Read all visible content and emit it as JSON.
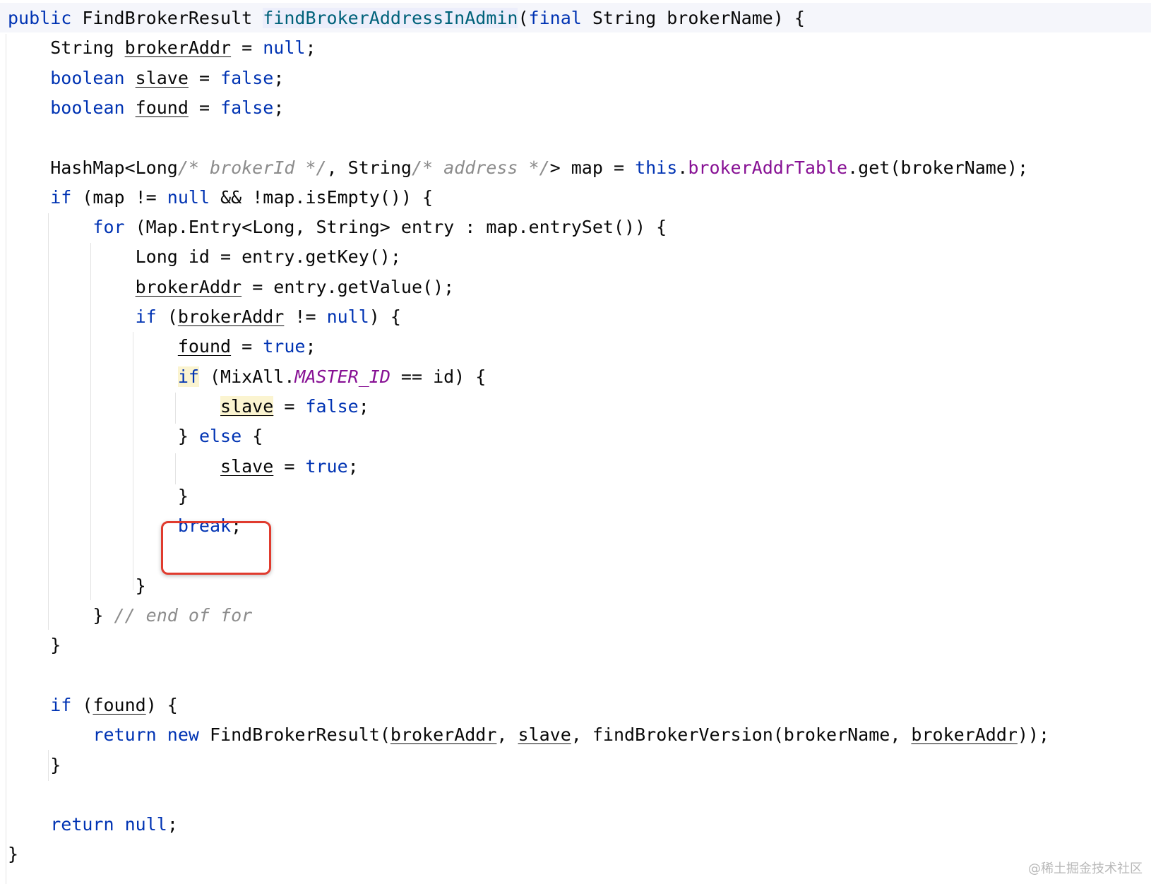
{
  "editor": {
    "lines": [
      {
        "tokens": [
          {
            "t": "public",
            "c": "kw"
          },
          {
            "t": " FindBrokerResult ",
            "c": ""
          },
          {
            "t": "findBrokerAddressInAdmin",
            "c": "fn hl-method"
          },
          {
            "t": "(",
            "c": ""
          },
          {
            "t": "final",
            "c": "kw"
          },
          {
            "t": " String brokerName) {",
            "c": ""
          }
        ]
      },
      {
        "tokens": [
          {
            "t": "    String ",
            "c": ""
          },
          {
            "t": "brokerAddr",
            "c": "u"
          },
          {
            "t": " = ",
            "c": ""
          },
          {
            "t": "null",
            "c": "kw"
          },
          {
            "t": ";",
            "c": ""
          }
        ]
      },
      {
        "tokens": [
          {
            "t": "    ",
            "c": ""
          },
          {
            "t": "boolean",
            "c": "kw"
          },
          {
            "t": " ",
            "c": ""
          },
          {
            "t": "slave",
            "c": "u"
          },
          {
            "t": " = ",
            "c": ""
          },
          {
            "t": "false",
            "c": "kw"
          },
          {
            "t": ";",
            "c": ""
          }
        ]
      },
      {
        "tokens": [
          {
            "t": "    ",
            "c": ""
          },
          {
            "t": "boolean",
            "c": "kw"
          },
          {
            "t": " ",
            "c": ""
          },
          {
            "t": "found",
            "c": "u"
          },
          {
            "t": " = ",
            "c": ""
          },
          {
            "t": "false",
            "c": "kw"
          },
          {
            "t": ";",
            "c": ""
          }
        ]
      },
      {
        "tokens": []
      },
      {
        "tokens": [
          {
            "t": "    HashMap<Long",
            "c": ""
          },
          {
            "t": "/* brokerId */",
            "c": "cmt"
          },
          {
            "t": ", String",
            "c": ""
          },
          {
            "t": "/* address */",
            "c": "cmt"
          },
          {
            "t": "> map = ",
            "c": ""
          },
          {
            "t": "this",
            "c": "kw"
          },
          {
            "t": ".",
            "c": ""
          },
          {
            "t": "brokerAddrTable",
            "c": "fld"
          },
          {
            "t": ".get(brokerName);",
            "c": ""
          }
        ]
      },
      {
        "tokens": [
          {
            "t": "    ",
            "c": ""
          },
          {
            "t": "if",
            "c": "kw"
          },
          {
            "t": " (map != ",
            "c": ""
          },
          {
            "t": "null",
            "c": "kw"
          },
          {
            "t": " && !map.isEmpty()) {",
            "c": ""
          }
        ]
      },
      {
        "tokens": [
          {
            "t": "        ",
            "c": ""
          },
          {
            "t": "for",
            "c": "kw"
          },
          {
            "t": " (Map.Entry<Long, String> entry : map.entrySet()) {",
            "c": ""
          }
        ]
      },
      {
        "tokens": [
          {
            "t": "            Long id = entry.getKey();",
            "c": ""
          }
        ]
      },
      {
        "tokens": [
          {
            "t": "            ",
            "c": ""
          },
          {
            "t": "brokerAddr",
            "c": "u"
          },
          {
            "t": " = entry.getValue();",
            "c": ""
          }
        ]
      },
      {
        "tokens": [
          {
            "t": "            ",
            "c": ""
          },
          {
            "t": "if",
            "c": "kw"
          },
          {
            "t": " (",
            "c": ""
          },
          {
            "t": "brokerAddr",
            "c": "u"
          },
          {
            "t": " != ",
            "c": ""
          },
          {
            "t": "null",
            "c": "kw"
          },
          {
            "t": ") {",
            "c": ""
          }
        ]
      },
      {
        "tokens": [
          {
            "t": "                ",
            "c": ""
          },
          {
            "t": "found",
            "c": "u"
          },
          {
            "t": " = ",
            "c": ""
          },
          {
            "t": "true",
            "c": "kw"
          },
          {
            "t": ";",
            "c": ""
          }
        ]
      },
      {
        "tokens": [
          {
            "t": "                ",
            "c": ""
          },
          {
            "t": "if",
            "c": "kw hl-yellow"
          },
          {
            "t": " (MixAll.",
            "c": ""
          },
          {
            "t": "MASTER_ID",
            "c": "cst"
          },
          {
            "t": " == id) {",
            "c": ""
          }
        ]
      },
      {
        "tokens": [
          {
            "t": "                    ",
            "c": ""
          },
          {
            "t": "slave",
            "c": "u hl-yellow"
          },
          {
            "t": " = ",
            "c": ""
          },
          {
            "t": "false",
            "c": "kw"
          },
          {
            "t": ";",
            "c": ""
          }
        ]
      },
      {
        "tokens": [
          {
            "t": "                } ",
            "c": ""
          },
          {
            "t": "else",
            "c": "kw"
          },
          {
            "t": " {",
            "c": ""
          }
        ]
      },
      {
        "tokens": [
          {
            "t": "                    ",
            "c": ""
          },
          {
            "t": "slave",
            "c": "u"
          },
          {
            "t": " = ",
            "c": ""
          },
          {
            "t": "true",
            "c": "kw"
          },
          {
            "t": ";",
            "c": ""
          }
        ]
      },
      {
        "tokens": [
          {
            "t": "                }",
            "c": ""
          }
        ]
      },
      {
        "tokens": [
          {
            "t": "                ",
            "c": ""
          },
          {
            "t": "break",
            "c": "kw"
          },
          {
            "t": ";",
            "c": ""
          }
        ]
      },
      {
        "tokens": []
      },
      {
        "tokens": [
          {
            "t": "            }",
            "c": ""
          }
        ]
      },
      {
        "tokens": [
          {
            "t": "        } ",
            "c": ""
          },
          {
            "t": "// end of for",
            "c": "cmt"
          }
        ]
      },
      {
        "tokens": [
          {
            "t": "    }",
            "c": ""
          }
        ]
      },
      {
        "tokens": []
      },
      {
        "tokens": [
          {
            "t": "    ",
            "c": ""
          },
          {
            "t": "if",
            "c": "kw"
          },
          {
            "t": " (",
            "c": ""
          },
          {
            "t": "found",
            "c": "u"
          },
          {
            "t": ") {",
            "c": ""
          }
        ]
      },
      {
        "tokens": [
          {
            "t": "        ",
            "c": ""
          },
          {
            "t": "return",
            "c": "kw"
          },
          {
            "t": " ",
            "c": ""
          },
          {
            "t": "new",
            "c": "kw"
          },
          {
            "t": " FindBrokerResult(",
            "c": ""
          },
          {
            "t": "brokerAddr",
            "c": "u"
          },
          {
            "t": ", ",
            "c": ""
          },
          {
            "t": "slave",
            "c": "u"
          },
          {
            "t": ", findBrokerVersion(brokerName, ",
            "c": ""
          },
          {
            "t": "brokerAddr",
            "c": "u"
          },
          {
            "t": "));",
            "c": ""
          }
        ]
      },
      {
        "tokens": [
          {
            "t": "    }",
            "c": ""
          }
        ]
      },
      {
        "tokens": []
      },
      {
        "tokens": [
          {
            "t": "    ",
            "c": ""
          },
          {
            "t": "return",
            "c": "kw"
          },
          {
            "t": " ",
            "c": ""
          },
          {
            "t": "null",
            "c": "kw"
          },
          {
            "t": ";",
            "c": ""
          }
        ]
      },
      {
        "tokens": [
          {
            "t": "}",
            "c": ""
          }
        ]
      }
    ]
  },
  "watermark": "@稀土掘金技术社区",
  "colors": {
    "keyword": "#0033b3",
    "method": "#00627a",
    "field": "#871094",
    "comment": "#8c8c8c",
    "highlight_box": "#e03b2e"
  }
}
